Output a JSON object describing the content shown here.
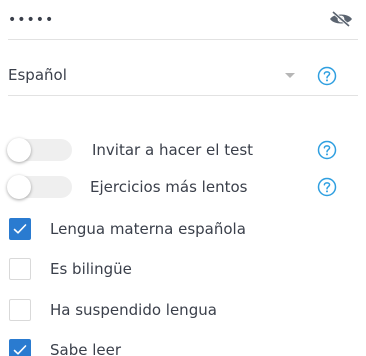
{
  "password": {
    "masked_value": "•••••",
    "visibility_icon": "eye-slash-icon"
  },
  "language": {
    "selected": "Español",
    "help_icon": "question-circle-icon"
  },
  "toggles": [
    {
      "label": "Invitar a hacer el test",
      "on": false,
      "help_icon": "question-circle-icon"
    },
    {
      "label": "Ejercicios más lentos",
      "on": false,
      "help_icon": "question-circle-icon"
    }
  ],
  "checkboxes": [
    {
      "label": "Lengua materna española",
      "checked": true
    },
    {
      "label": "Es bilingüe",
      "checked": false
    },
    {
      "label": "Ha suspendido lengua",
      "checked": false
    },
    {
      "label": "Sabe leer",
      "checked": true
    }
  ],
  "colors": {
    "accent": "#2a7bd0",
    "help_icon": "#2f9fe0"
  }
}
